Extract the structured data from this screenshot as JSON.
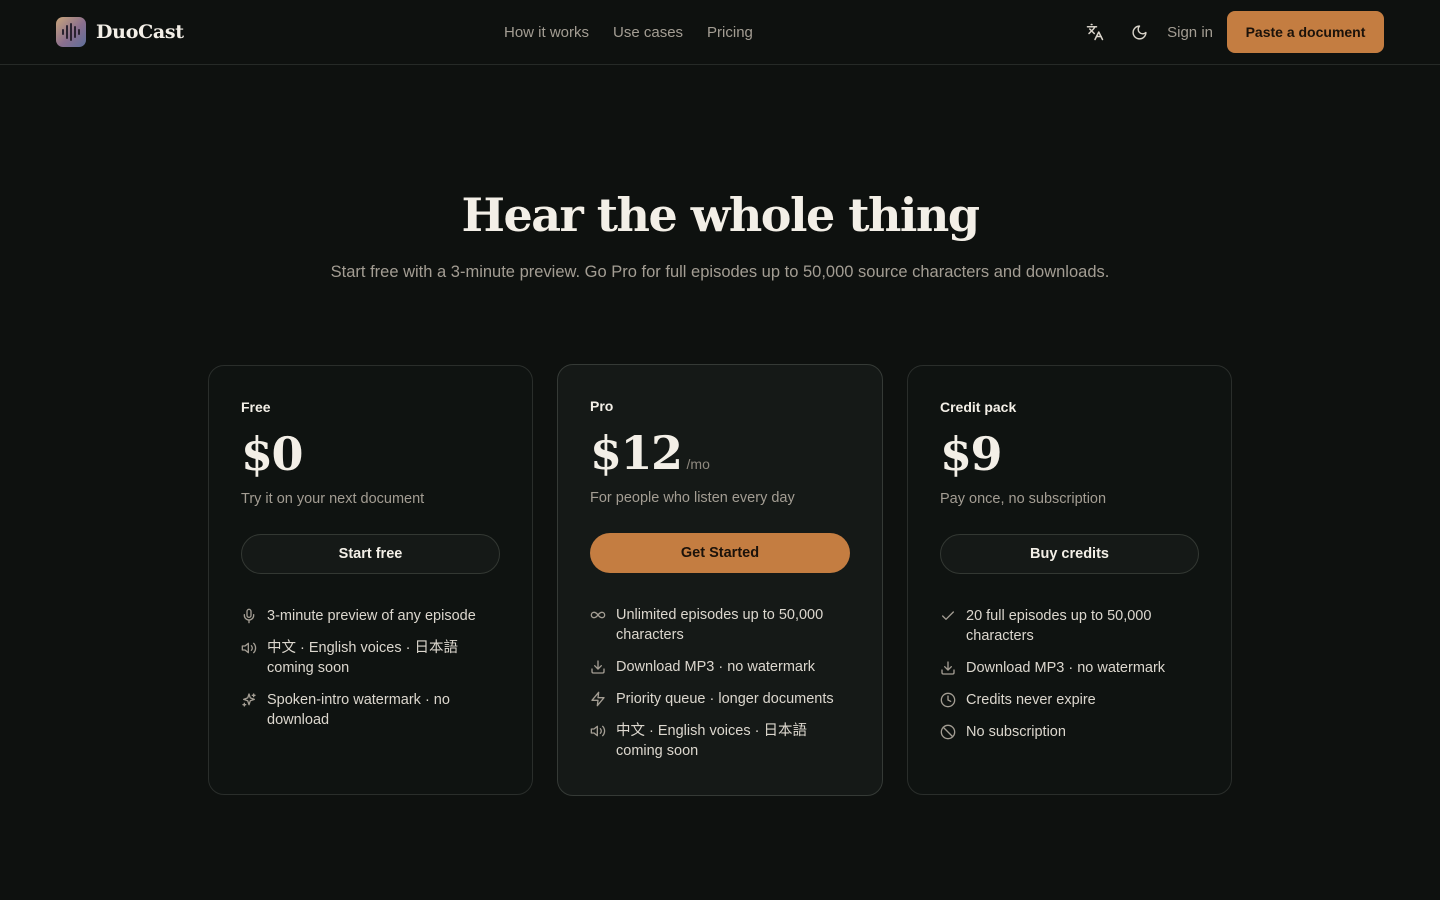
{
  "header": {
    "brand": "DuoCast",
    "nav": [
      "How it works",
      "Use cases",
      "Pricing"
    ],
    "signin": "Sign in",
    "cta": "Paste a document"
  },
  "hero": {
    "title": "Hear the whole thing",
    "subtitle": "Start free with a 3-minute preview. Go Pro for full episodes up to 50,000 source characters and downloads."
  },
  "plans": [
    {
      "name": "Free",
      "price": "$0",
      "per": "",
      "desc": "Try it on your next document",
      "button": "Start free",
      "features": [
        {
          "icon": "mic-icon",
          "text": "3-minute preview of any episode"
        },
        {
          "icon": "speaker-icon",
          "text": "中文 · English voices · 日本語 coming soon"
        },
        {
          "icon": "sparkle-icon",
          "text": "Spoken-intro watermark · no download"
        }
      ]
    },
    {
      "name": "Pro",
      "price": "$12",
      "per": "/mo",
      "desc": "For people who listen every day",
      "button": "Get Started",
      "features": [
        {
          "icon": "infinity-icon",
          "text": "Unlimited episodes up to 50,000 characters"
        },
        {
          "icon": "download-icon",
          "text": "Download MP3 · no watermark"
        },
        {
          "icon": "bolt-icon",
          "text": "Priority queue · longer documents"
        },
        {
          "icon": "speaker-icon",
          "text": "中文 · English voices · 日本語 coming soon"
        }
      ]
    },
    {
      "name": "Credit pack",
      "price": "$9",
      "per": "",
      "desc": "Pay once, no subscription",
      "button": "Buy credits",
      "features": [
        {
          "icon": "check-icon",
          "text": "20 full episodes up to 50,000 characters"
        },
        {
          "icon": "download-icon",
          "text": "Download MP3 · no watermark"
        },
        {
          "icon": "clock-icon",
          "text": "Credits never expire"
        },
        {
          "icon": "ban-icon",
          "text": "No subscription"
        }
      ]
    }
  ],
  "colors": {
    "background": "#0e110f",
    "accent": "#c47d41",
    "text": "#f3efe7",
    "muted": "#a39d93"
  }
}
